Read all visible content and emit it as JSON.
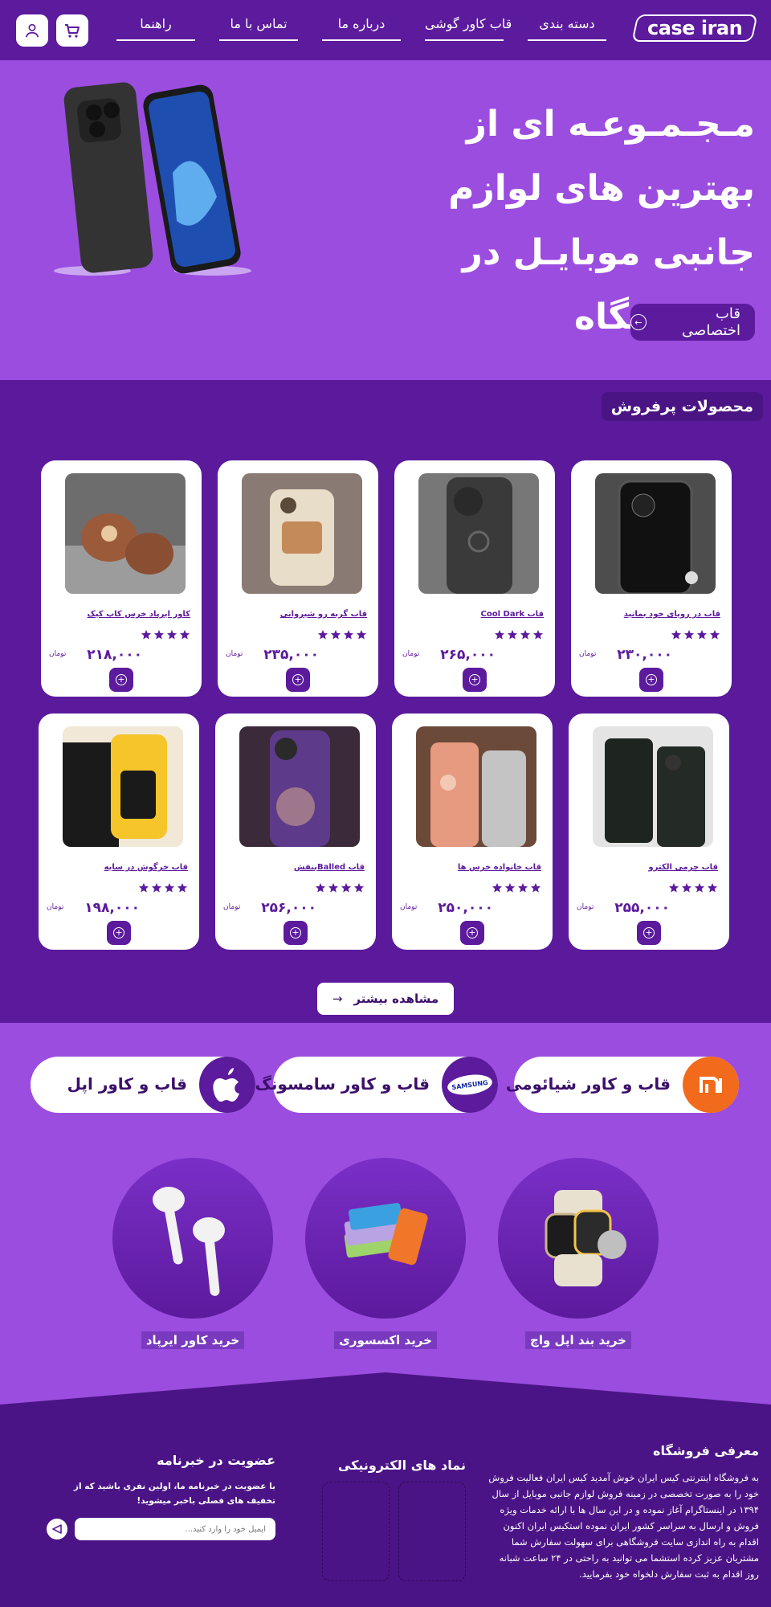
{
  "header": {
    "logo_text": "case iran",
    "nav": [
      "دسته بندی",
      "قاب کاور گوشی",
      "درباره ما",
      "تماس با ما",
      "راهنما"
    ],
    "cart_icon": "cart-icon",
    "user_icon": "user-icon"
  },
  "hero": {
    "title": "مـجـمـوعـه ای از بهترین های لوازم جانبی موبایـل در فـروشـگاه",
    "button_label": "قاب اختصاصی"
  },
  "bestsellers": {
    "title": "محصولات پرفروش",
    "currency": "تومان",
    "rating_stars": 4,
    "products": [
      {
        "name": "قاب در رویای خود بمانید",
        "price": "۲۳۰,۰۰۰"
      },
      {
        "name": "قاب Cool Dark",
        "price": "۲۶۵,۰۰۰"
      },
      {
        "name": "قاب گربه رو شیروانی",
        "price": "۲۳۵,۰۰۰"
      },
      {
        "name": "کاور ایرپاد خرس کاپ کیک",
        "price": "۲۱۸,۰۰۰"
      },
      {
        "name": "قاب چرمی الکترو",
        "price": "۲۵۵,۰۰۰"
      },
      {
        "name": "قاب خانواده خرس ها",
        "price": "۲۵۰,۰۰۰"
      },
      {
        "name": "قاب Balledبنفش",
        "price": "۲۵۶,۰۰۰"
      },
      {
        "name": "قاب خرگوش در سایه",
        "price": "۱۹۸,۰۰۰"
      }
    ],
    "more_label": "مشاهده بیشتر"
  },
  "brands": [
    {
      "label": "قاب و کاور شیائومی",
      "badge": "mi",
      "color": "#f26a1b"
    },
    {
      "label": "قاب و کاور سامسونگ",
      "badge": "SAMSUNG",
      "color": "#5c1a9d"
    },
    {
      "label": "قاب و کاور اپل",
      "badge": "apple",
      "color": "#5c1a9d"
    }
  ],
  "categories": [
    {
      "label": "خرید بند اپل واچ"
    },
    {
      "label": "خرید اکسسوری"
    },
    {
      "label": "خرید کاور ایرپاد"
    }
  ],
  "footer": {
    "about_title": "معرفی فروشگاه",
    "about_text": "به فروشگاه اینترنتی کیس ایران خوش آمدید کیس ایران فعالیت فروش خود را به صورت تخصصی در زمینه فروش لوازم جانبی موبایل از سال ۱۳۹۴ در اینستاگرام آغاز نموده و در این سال ها با ارائه خدمات ویژه فروش و ارسال به سراسر کشور ایران نموده استکیس ایران اکنون اقدام به راه اندازی سایت فروشگاهی برای سهولت سفارش شما مشتریان عزیز کرده استشما می توانید به راحتی در ۲۴ ساعت شبانه روز اقدام به ثبت سفارش دلخواه خود بفرمایید.",
    "enamad_title": "نماد های الکترونیکی",
    "news_title": "عضویت در خبرنامه",
    "news_text": "با عضویت در خبرنامه ما، اولین نفری باشید که از تخفیف های فصلی باخبر میشوید!",
    "email_placeholder": "ایمیل خود را وارد کنید..."
  }
}
